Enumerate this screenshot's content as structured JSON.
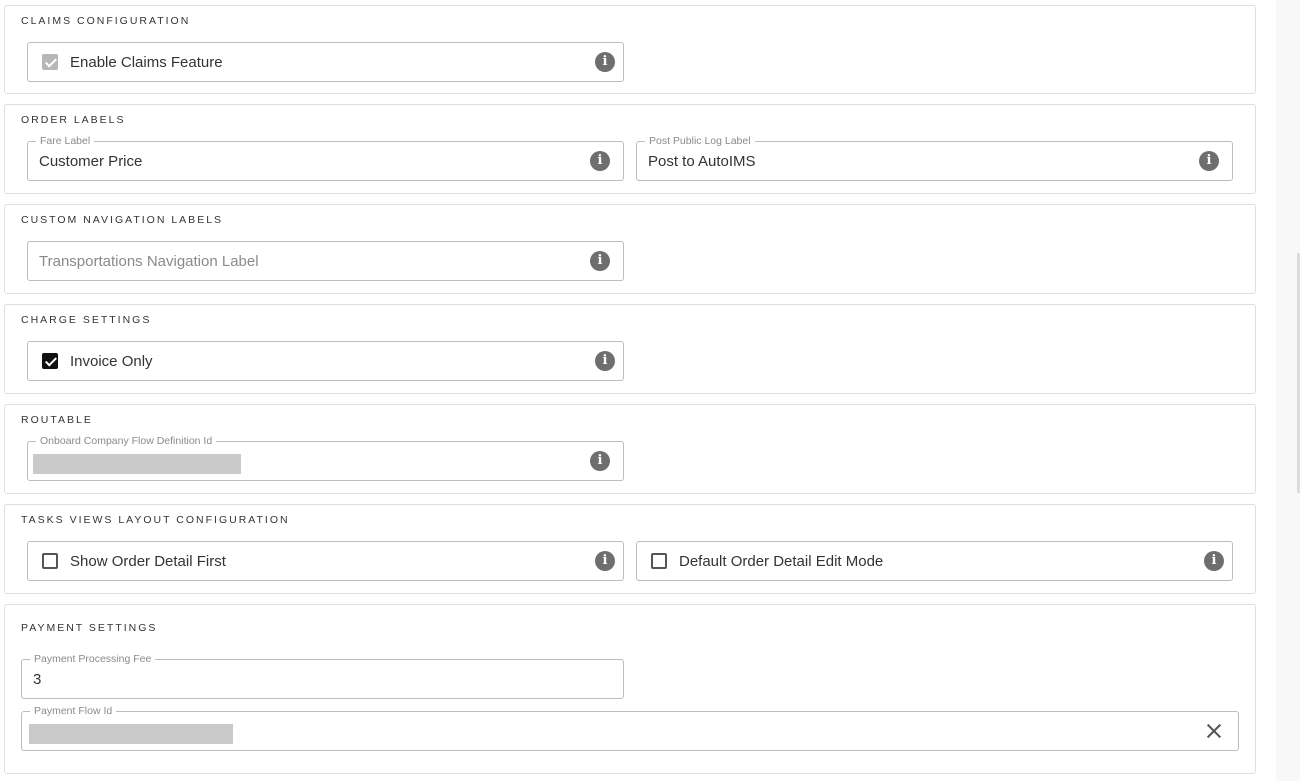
{
  "sections": {
    "claims": {
      "title": "CLAIMS CONFIGURATION",
      "enable_claims": {
        "label": "Enable Claims Feature",
        "checked": true,
        "disabled": true
      }
    },
    "order_labels": {
      "title": "ORDER LABELS",
      "fare_label": {
        "legend": "Fare Label",
        "value": "Customer Price"
      },
      "post_public_log_label": {
        "legend": "Post Public Log Label",
        "value": "Post to AutoIMS"
      }
    },
    "custom_navigation": {
      "title": "CUSTOM NAVIGATION LABELS",
      "transportations_label": {
        "placeholder": "Transportations Navigation Label"
      }
    },
    "charge_settings": {
      "title": "CHARGE SETTINGS",
      "invoice_only": {
        "label": "Invoice Only",
        "checked": true
      }
    },
    "routable": {
      "title": "ROUTABLE",
      "flow_definition": {
        "legend": "Onboard Company Flow Definition Id"
      }
    },
    "tasks_views": {
      "title": "TASKS VIEWS LAYOUT CONFIGURATION",
      "show_order_detail_first": {
        "label": "Show Order Detail First",
        "checked": false
      },
      "default_edit_mode": {
        "label": "Default Order Detail Edit Mode",
        "checked": false
      }
    },
    "payment_settings": {
      "title": "PAYMENT SETTINGS",
      "processing_fee": {
        "legend": "Payment Processing Fee",
        "value": "3"
      },
      "payment_flow": {
        "legend": "Payment Flow Id"
      }
    }
  },
  "icons": {
    "info": "info-icon",
    "clear": "close-icon"
  },
  "colors": {
    "info_icon": "#6e6e6e",
    "checked_box": "#111111",
    "disabled_box": "#b7b7b7",
    "border": "#bdbdbd"
  }
}
